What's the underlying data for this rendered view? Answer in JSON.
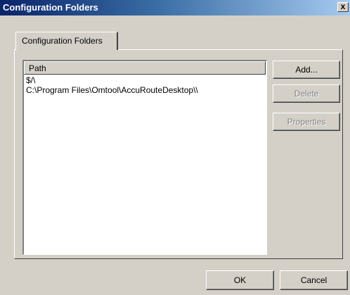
{
  "window": {
    "title": "Configuration Folders",
    "close_glyph": "x",
    "close_icon": "close-icon"
  },
  "tabs": [
    {
      "label": "Configuration Folders",
      "selected": true
    }
  ],
  "list": {
    "columns": [
      "Path"
    ],
    "rows": [
      "$/\\",
      "C:\\Program Files\\Omtool\\AccuRouteDesktop\\\\"
    ]
  },
  "side_buttons": {
    "add": "Add...",
    "delete": "Delete",
    "properties": "Properties"
  },
  "footer_buttons": {
    "ok": "OK",
    "cancel": "Cancel"
  },
  "colors": {
    "titlebar_start": "#0a246a",
    "titlebar_end": "#a6caf0",
    "face": "#d4d0c8",
    "disabled_text": "#808080"
  }
}
